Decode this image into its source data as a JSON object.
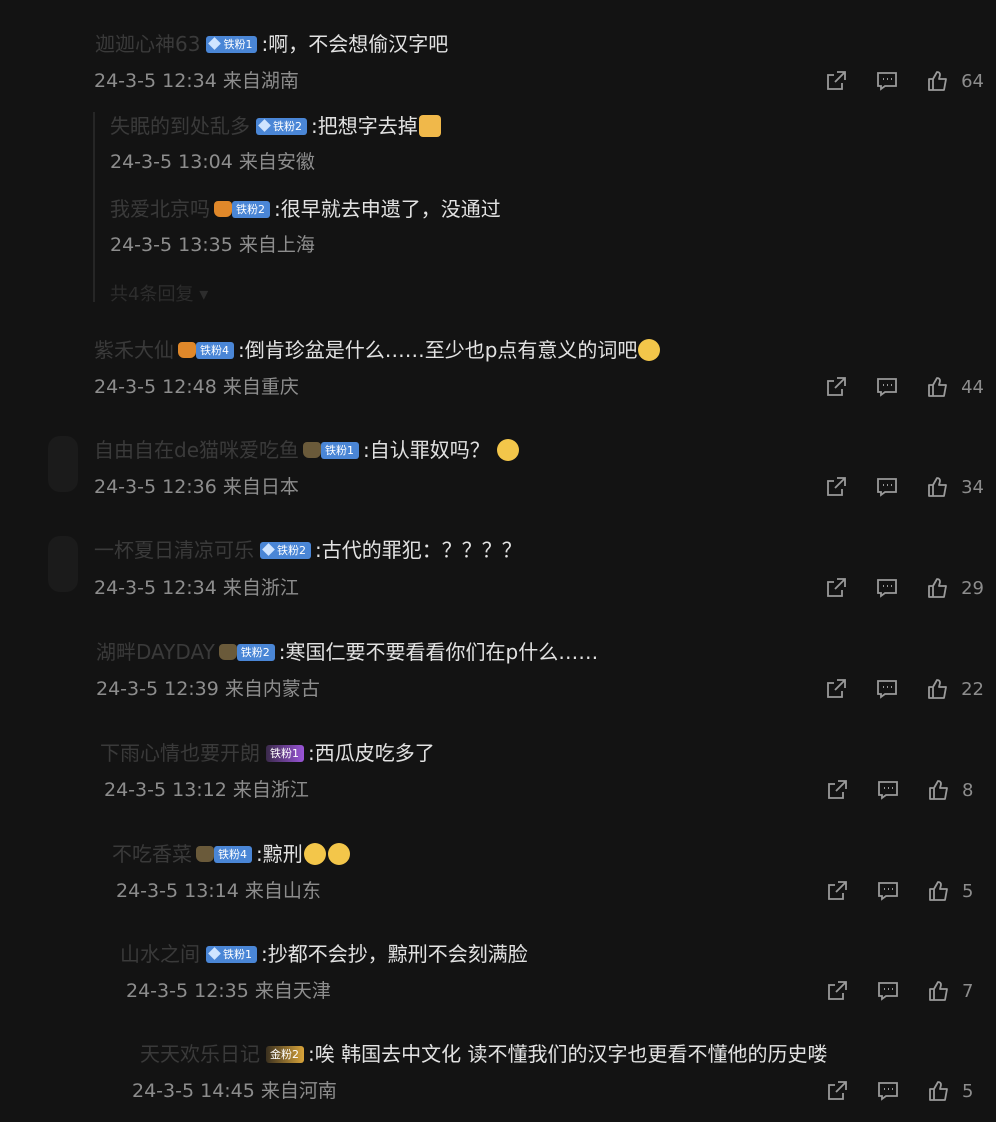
{
  "comments": [
    {
      "user": "迦迦心神63",
      "badge": "铁粉1",
      "badge_style": "blue",
      "text": ":啊，不会想偷汉字吧",
      "meta": "24-3-5 12:34 来自湖南",
      "likes": "64"
    },
    {
      "user": "失眠的到处乱多",
      "badge": "铁粉2",
      "badge_style": "blue",
      "text": ":把想字去掉",
      "meta": "24-3-5 13:04 来自安徽"
    },
    {
      "user": "我爱北京吗",
      "badge": "铁粉2",
      "badge_style": "blue",
      "text": ":很早就去申遗了，没通过",
      "meta": "24-3-5 13:35 来自上海"
    },
    {
      "user": "紫禾大仙",
      "badge": "铁粉4",
      "badge_style": "blue",
      "text": ":倒肯珍盆是什么……至少也p点有意义的词吧",
      "meta": "24-3-5 12:48 来自重庆",
      "likes": "44"
    },
    {
      "user": "自由自在de猫咪爱吃鱼",
      "badge": "铁粉1",
      "badge_style": "blue",
      "text": ":自认罪奴吗？",
      "meta": "24-3-5 12:36 来自日本",
      "likes": "34"
    },
    {
      "user": "一杯夏日清凉可乐",
      "badge": "铁粉2",
      "badge_style": "blue",
      "text": ":古代的罪犯：？？？？",
      "meta": "24-3-5 12:34 来自浙江",
      "likes": "29"
    },
    {
      "user": "湖畔DAYDAY",
      "badge": "铁粉2",
      "badge_style": "blue",
      "text": ":寒国仁要不要看看你们在p什么……",
      "meta": "24-3-5 12:39 来自内蒙古",
      "likes": "22"
    },
    {
      "user": "下雨心情也要开朗",
      "badge": "铁粉1",
      "badge_style": "purple",
      "text": ":西瓜皮吃多了",
      "meta": "24-3-5 13:12 来自浙江",
      "likes": "8"
    },
    {
      "user": "不吃香菜",
      "badge": "铁粉4",
      "badge_style": "blue",
      "text": ":黥刑",
      "meta": "24-3-5 13:14 来自山东",
      "likes": "5"
    },
    {
      "user": "山水之间",
      "badge": "铁粉1",
      "badge_style": "blue",
      "text": ":抄都不会抄，黥刑不会刻满脸",
      "meta": "24-3-5 12:35 来自天津",
      "likes": "7"
    },
    {
      "user": "天天欢乐日记",
      "badge": "金粉2",
      "badge_style": "gold",
      "text": ":唉  韩国去中文化 读不懂我们的汉字也更看不懂他的历史喽",
      "meta": "24-3-5 14:45 来自河南",
      "likes": "5"
    }
  ],
  "thread": {
    "more_replies": "共4条回复"
  },
  "icons": {
    "share": "share-icon",
    "comment": "comment-icon",
    "like": "thumbs-up-icon"
  },
  "colors": {
    "background": "#131313",
    "text": "#e2e2e2",
    "meta": "#8d8d8d",
    "badge": "#4a86d6"
  }
}
